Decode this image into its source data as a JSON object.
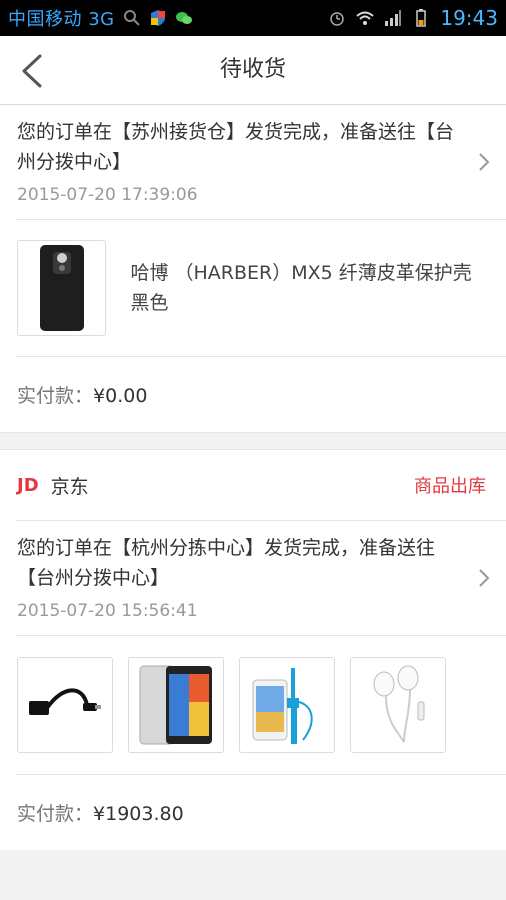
{
  "status_bar": {
    "carrier": "中国移动 3G",
    "time": "19:43",
    "icons": [
      "search-icon",
      "shield-icon",
      "wechat-icon",
      "alarm-icon",
      "wifi-icon",
      "signal-icon",
      "battery-icon"
    ],
    "accent_color": "#39a7ff"
  },
  "header": {
    "title": "待收货",
    "back_icon": "chevron-left-icon"
  },
  "orders": [
    {
      "logistics_text": "您的订单在【苏州接货仓】发货完成，准备送往【台州分拨中心】",
      "logistics_time": "2015-07-20 17:39:06",
      "products": [
        {
          "icon": "phone-case-icon",
          "name": "哈博 （HARBER）MX5 纤薄皮革保护壳 黑色"
        }
      ],
      "pay_label": "实付款：",
      "pay_amount": "¥0.00"
    },
    {
      "store_logo": "JD",
      "store_name": "京东",
      "store_status": "商品出库",
      "store_status_color": "#e4393c",
      "logistics_text": "您的订单在【杭州分拣中心】发货完成，准备送往【台州分拨中心】",
      "logistics_time": "2015-07-20 15:56:41",
      "products": [
        {
          "icon": "otg-cable-icon"
        },
        {
          "icon": "smartphone-icon"
        },
        {
          "icon": "selfie-stick-icon"
        },
        {
          "icon": "earphones-icon"
        }
      ],
      "pay_label": "实付款：",
      "pay_amount": "¥1903.80"
    }
  ]
}
